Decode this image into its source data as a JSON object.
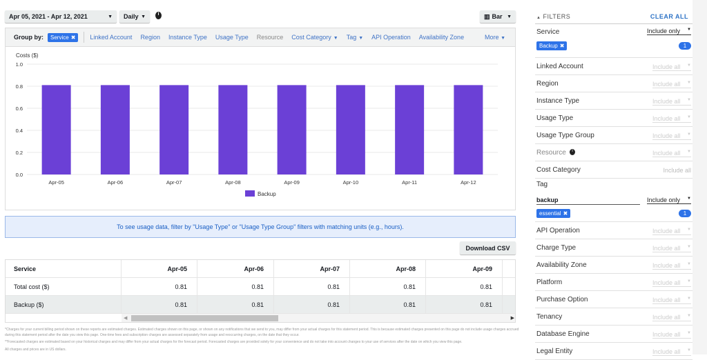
{
  "toolbar": {
    "date_range": "Apr 05, 2021 - Apr 12, 2021",
    "granularity": "Daily",
    "chart_type": "Bar"
  },
  "group_by": {
    "label": "Group by:",
    "selected": "Service",
    "options": [
      {
        "label": "Linked Account",
        "dropdown": false,
        "enabled": true
      },
      {
        "label": "Region",
        "dropdown": false,
        "enabled": true
      },
      {
        "label": "Instance Type",
        "dropdown": false,
        "enabled": true
      },
      {
        "label": "Usage Type",
        "dropdown": false,
        "enabled": true
      },
      {
        "label": "Resource",
        "dropdown": false,
        "enabled": false
      },
      {
        "label": "Cost Category",
        "dropdown": true,
        "enabled": true
      },
      {
        "label": "Tag",
        "dropdown": true,
        "enabled": true
      },
      {
        "label": "API Operation",
        "dropdown": false,
        "enabled": true
      },
      {
        "label": "Availability Zone",
        "dropdown": false,
        "enabled": true
      }
    ],
    "more": "More"
  },
  "chart_data": {
    "type": "bar",
    "title": "",
    "ylabel": "Costs ($)",
    "xlabel": "",
    "ylim": [
      0,
      1.0
    ],
    "yticks": [
      "0.0",
      "0.2",
      "0.4",
      "0.6",
      "0.8",
      "1.0"
    ],
    "categories": [
      "Apr-05",
      "Apr-06",
      "Apr-07",
      "Apr-08",
      "Apr-09",
      "Apr-10",
      "Apr-11",
      "Apr-12"
    ],
    "series": [
      {
        "name": "Backup",
        "values": [
          0.81,
          0.81,
          0.81,
          0.81,
          0.81,
          0.81,
          0.81,
          0.81
        ],
        "color": "#6b40d6"
      }
    ],
    "legend": "bottom",
    "grid": true
  },
  "banner": "To see usage data, filter by \"Usage Type\" or \"Usage Type Group\" filters with matching units (e.g., hours).",
  "download_csv": "Download CSV",
  "table": {
    "headers": [
      "Service",
      "Apr-05",
      "Apr-06",
      "Apr-07",
      "Apr-08",
      "Apr-09"
    ],
    "rows": [
      [
        "Total cost ($)",
        "0.81",
        "0.81",
        "0.81",
        "0.81",
        "0.81"
      ],
      [
        "Backup ($)",
        "0.81",
        "0.81",
        "0.81",
        "0.81",
        "0.81"
      ]
    ]
  },
  "footer": [
    "*Charges for your current billing period shown on these reports are estimated charges. Estimated charges shown on this page, or shown on any notifications that we send to you, may differ from your actual charges for this statement period. This is because estimated charges presented on this page do not include usage charges accrued during this statement period after the date you view this page. One-time fees and subscription charges are assessed separately from usage and reoccurring charges, on the date that they occur.",
    "**Forecasted charges are estimated based on your historical charges and may differ from your actual charges for the forecast period. Forecasted charges are provided solely for your convenience and do not take into account changes to your use of services after the date on which you view this page.",
    "All charges and prices are in US dollars."
  ],
  "filters": {
    "title": "FILTERS",
    "clear_all": "CLEAR ALL",
    "service": {
      "label": "Service",
      "mode": "Include only",
      "chip": "Backup",
      "count": "1"
    },
    "items_a": [
      {
        "label": "Linked Account",
        "mode": "Include all"
      },
      {
        "label": "Region",
        "mode": "Include all"
      },
      {
        "label": "Instance Type",
        "mode": "Include all"
      },
      {
        "label": "Usage Type",
        "mode": "Include all"
      },
      {
        "label": "Usage Type Group",
        "mode": "Include all"
      },
      {
        "label": "Resource",
        "mode": "Include all",
        "info": true
      },
      {
        "label": "Cost Category",
        "mode": "Include all",
        "plain": true
      }
    ],
    "tag": {
      "label": "Tag",
      "key": "backup",
      "mode": "Include only",
      "chip": "essential",
      "count": "1"
    },
    "items_b": [
      {
        "label": "API Operation",
        "mode": "Include all"
      },
      {
        "label": "Charge Type",
        "mode": "Include all"
      },
      {
        "label": "Availability Zone",
        "mode": "Include all"
      },
      {
        "label": "Platform",
        "mode": "Include all"
      },
      {
        "label": "Purchase Option",
        "mode": "Include all"
      },
      {
        "label": "Tenancy",
        "mode": "Include all"
      },
      {
        "label": "Database Engine",
        "mode": "Include all"
      },
      {
        "label": "Legal Entity",
        "mode": "Include all"
      }
    ]
  }
}
